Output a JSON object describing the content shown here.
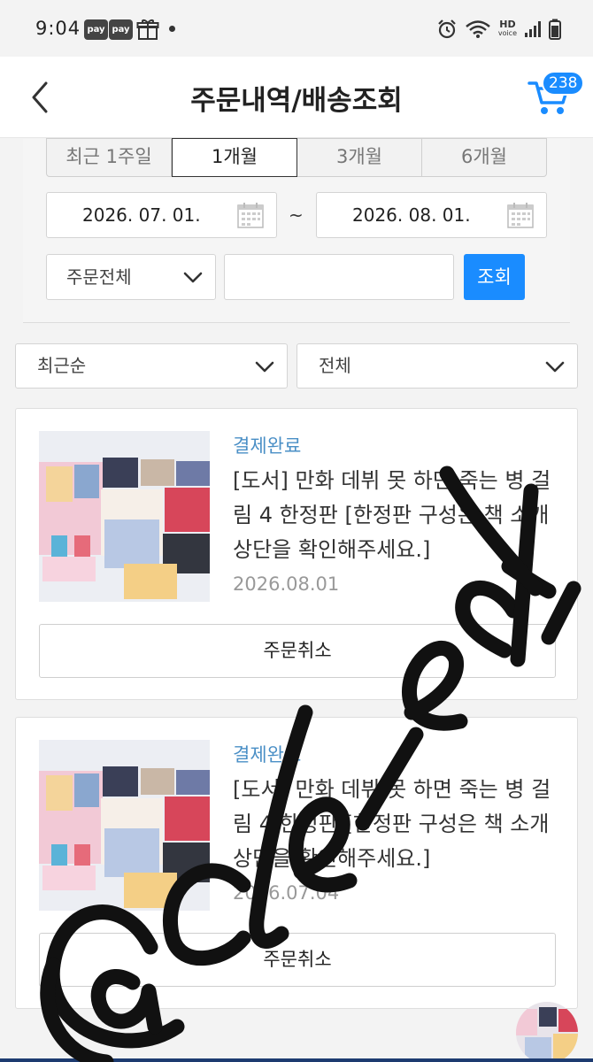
{
  "status_bar": {
    "time": "9:04",
    "pay1": "pay",
    "pay2": "pay",
    "hd": "HD",
    "hd_sub": "voice"
  },
  "header": {
    "title": "주문내역/배송조회",
    "cart_count": "238"
  },
  "filter": {
    "periods": [
      "최근 1주일",
      "1개월",
      "3개월",
      "6개월"
    ],
    "active_period": "1개월",
    "date_from": "2026. 07. 01.",
    "date_to": "2026. 08. 01.",
    "separator": "~",
    "order_type": "주문전체",
    "keyword": "",
    "search_button": "조회"
  },
  "sort": {
    "order": "최근순",
    "status": "전체"
  },
  "orders": [
    {
      "status": "결제완료",
      "title": "[도서] 만화 데뷔 못 하면 죽는 병 걸림 4 한정판 [한정판 구성은 책 소개 상단을 확인해주세요.]",
      "date": "2026.08.01",
      "cancel_label": "주문취소"
    },
    {
      "status": "결제완료",
      "title": "[도서] 만화 데뷔 못 하면 죽는 병 걸림 4 한정판 [한정판 구성은 책 소개 상단을 확인해주세요.]",
      "date": "2026.07.04",
      "cancel_label": "주문취소"
    }
  ],
  "watermark": "@cle_edi",
  "colors": {
    "accent": "#1a8cff",
    "status_text": "#4a8fc6"
  }
}
